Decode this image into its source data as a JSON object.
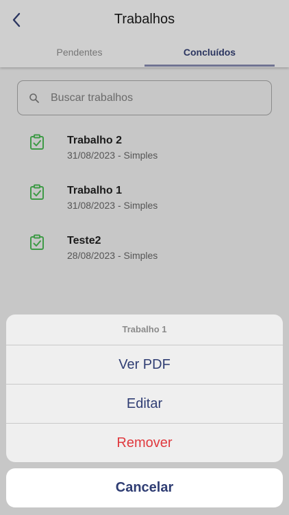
{
  "header": {
    "title": "Trabalhos",
    "tabs": [
      {
        "label": "Pendentes",
        "active": false
      },
      {
        "label": "Concluídos",
        "active": true
      }
    ]
  },
  "search": {
    "placeholder": "Buscar trabalhos",
    "value": ""
  },
  "list": {
    "items": [
      {
        "title": "Trabalho 2",
        "subtitle": "31/08/2023 - Simples",
        "icon": "clipboard-check-icon"
      },
      {
        "title": "Trabalho 1",
        "subtitle": "31/08/2023 - Simples",
        "icon": "clipboard-check-icon"
      },
      {
        "title": "Teste2",
        "subtitle": "28/08/2023 - Simples",
        "icon": "clipboard-check-icon"
      }
    ]
  },
  "action_sheet": {
    "title": "Trabalho 1",
    "actions": [
      {
        "label": "Ver PDF",
        "color": "#2f3d73"
      },
      {
        "label": "Editar",
        "color": "#2f3d73"
      },
      {
        "label": "Remover",
        "color": "#e0393e"
      }
    ],
    "cancel_label": "Cancelar"
  },
  "colors": {
    "accent": "#2b3560",
    "check_green": "#3e9a46",
    "destructive": "#e0393e"
  }
}
